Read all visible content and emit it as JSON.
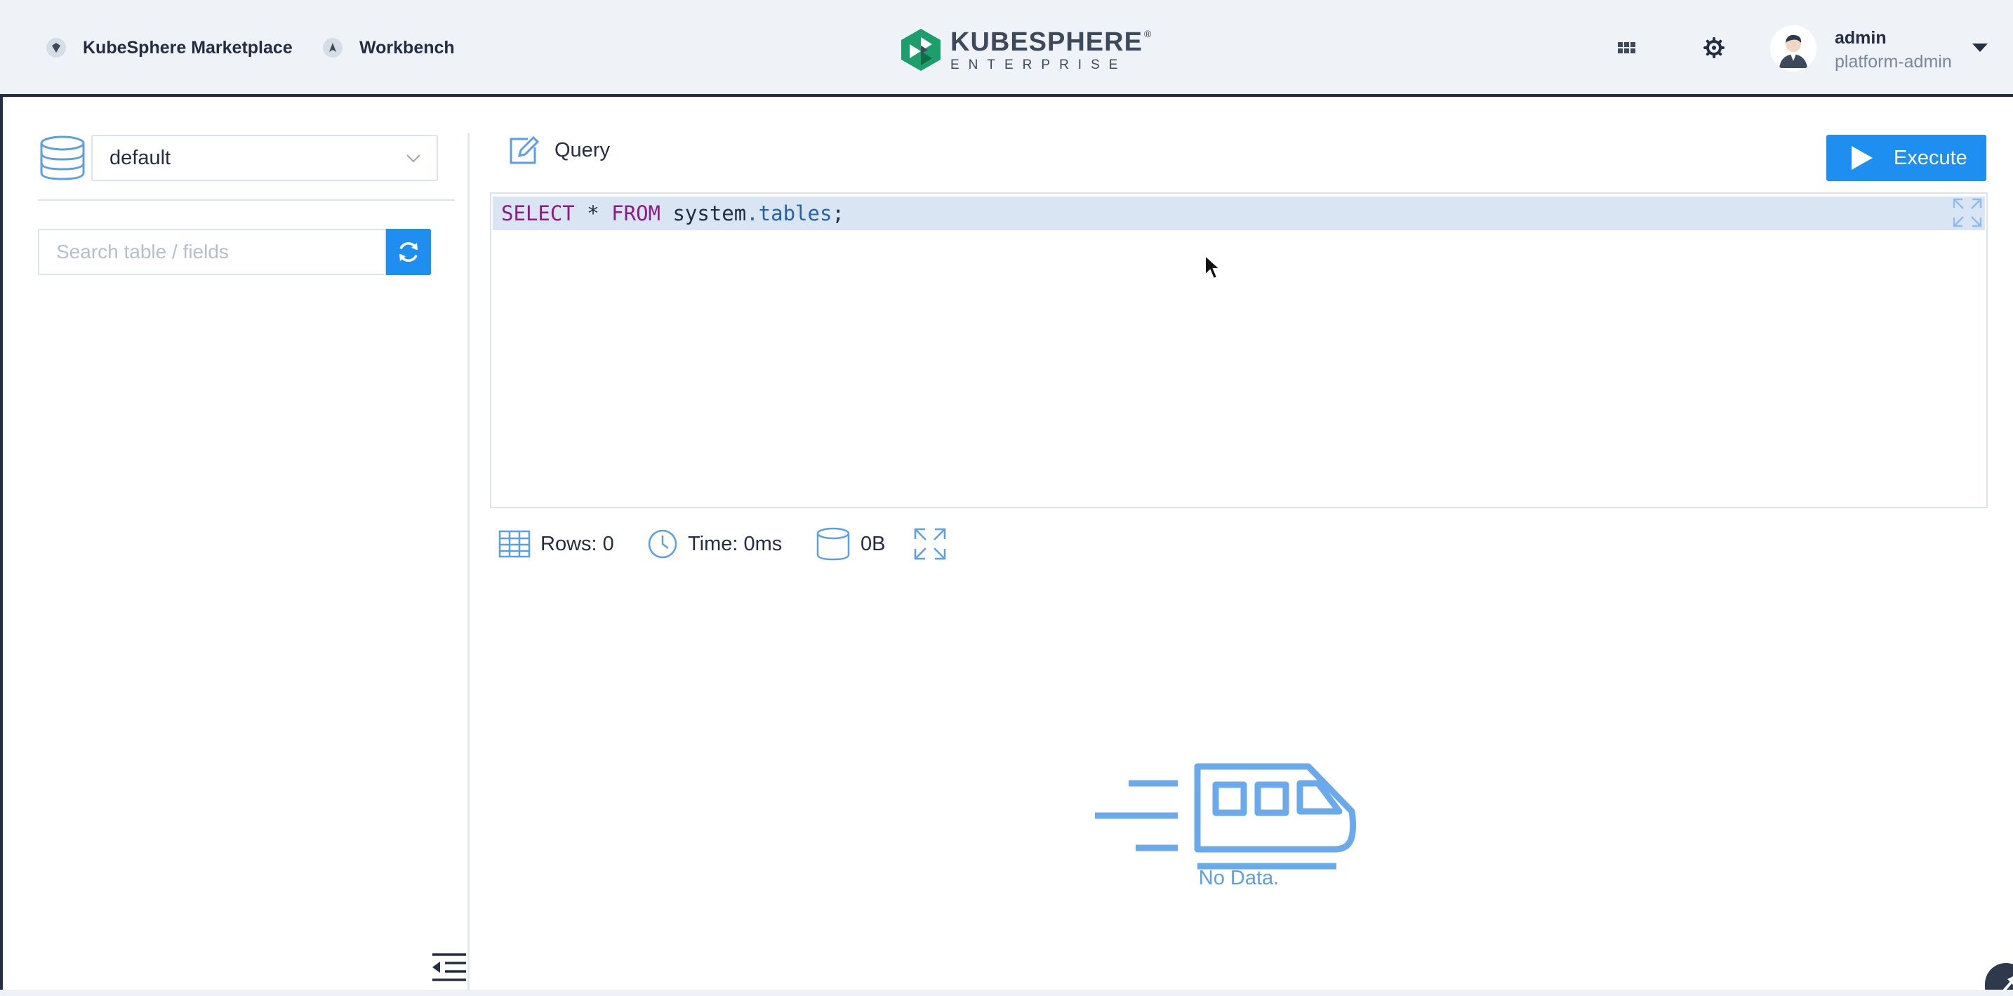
{
  "topbar": {
    "nav": [
      {
        "label": "KubeSphere Marketplace",
        "icon": "marketplace-icon"
      },
      {
        "label": "Workbench",
        "icon": "workbench-icon"
      }
    ],
    "logo": {
      "main": "KUBESPHERE",
      "reg": "®",
      "sub": "ENTERPRISE",
      "brand_color": "#1e9e6b"
    },
    "icons": [
      "apps-grid-icon",
      "gear-icon"
    ],
    "user": {
      "name": "admin",
      "role": "platform-admin"
    }
  },
  "sidebar": {
    "database": {
      "selected": "default",
      "icon": "database-icon"
    },
    "search": {
      "placeholder": "Search table / fields",
      "value": ""
    },
    "refresh_icon": "refresh-icon",
    "collapse_icon": "collapse-menu-icon"
  },
  "query": {
    "label": "Query",
    "execute_label": "Execute",
    "sql": {
      "kw1": "SELECT",
      "star": " * ",
      "kw2": "FROM",
      "ident": " system",
      "prop": ".tables",
      "end": ";"
    }
  },
  "stats": {
    "rows": "Rows: 0",
    "time": "Time: 0ms",
    "size": "0B"
  },
  "empty": {
    "text": "No Data.",
    "icon": "train-icon"
  },
  "colors": {
    "accent": "#1e8ff0",
    "empty_blue": "#5b9fe8",
    "nav_dark": "#242e42"
  }
}
